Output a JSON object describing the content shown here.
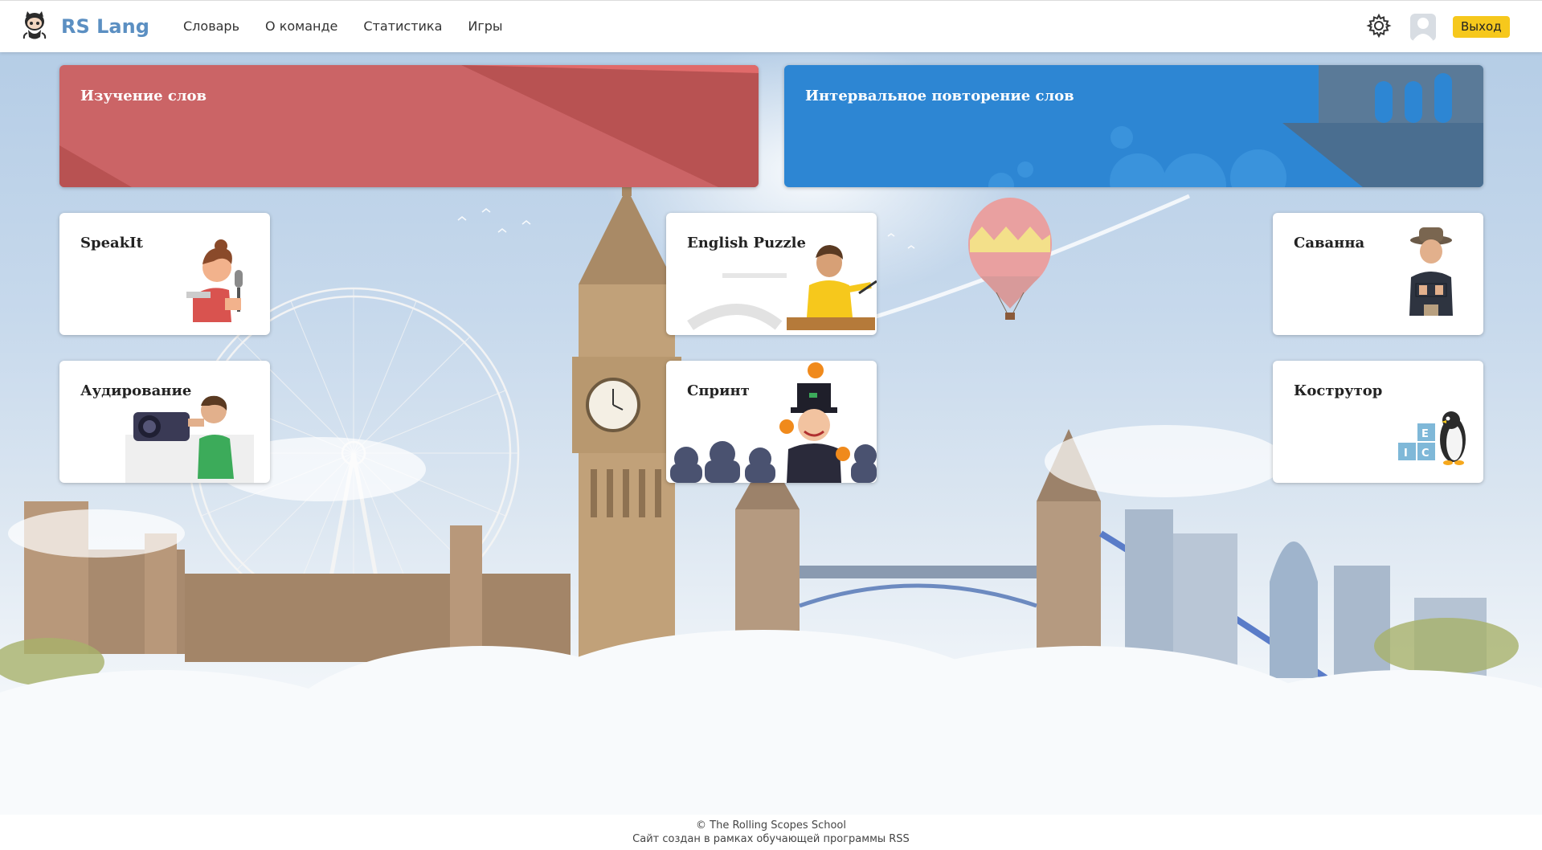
{
  "header": {
    "brand": "RS Lang",
    "nav": [
      "Словарь",
      "О команде",
      "Статистика",
      "Игры"
    ],
    "logout_label": "Выход"
  },
  "icons": {
    "logo": "github-octocat-icon",
    "settings": "gear-icon",
    "user": "avatar-icon"
  },
  "colors": {
    "brand": "#5b8fc2",
    "logout_bg": "#f6c81c",
    "learn_card": "#cb6466",
    "repeat_card": "#2d86d3"
  },
  "big_cards": [
    {
      "title": "Изучение слов"
    },
    {
      "title": "Интервальное повторение слов"
    }
  ],
  "games": [
    {
      "title": "SpeakIt"
    },
    {
      "title": "English Puzzle"
    },
    {
      "title": "Саванна"
    },
    {
      "title": "Аудирование"
    },
    {
      "title": "Спринт"
    },
    {
      "title": "Кострутор"
    }
  ],
  "footer": {
    "line1": "© The Rolling Scopes School",
    "line2": "Сайт создан в рамках обучающей программы RSS"
  }
}
